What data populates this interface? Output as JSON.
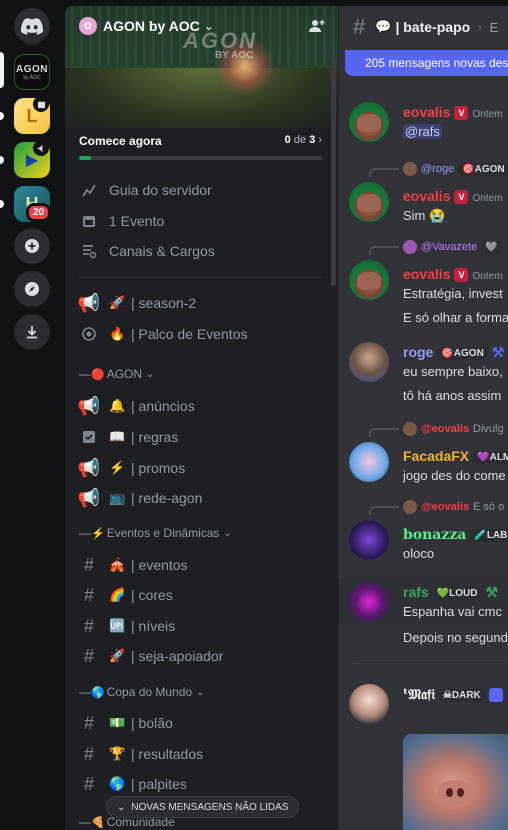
{
  "rail": {
    "servers": [
      {
        "name": "discord-home",
        "icon": "discord-logo-icon"
      },
      {
        "name": "AGON",
        "label": "AGON",
        "sublabel": "by AOC",
        "selected": true
      },
      {
        "name": "L-server",
        "label": "L"
      },
      {
        "name": "brazil-server",
        "label": "▶"
      },
      {
        "name": "H-server",
        "label": "H",
        "badge": "20"
      }
    ],
    "actions": [
      {
        "name": "add-server",
        "icon": "plus-icon"
      },
      {
        "name": "discover",
        "icon": "compass-icon"
      },
      {
        "name": "download",
        "icon": "download-icon"
      }
    ]
  },
  "sidebar": {
    "server_name": "AGON by AOC",
    "banner_logo": "AGON",
    "banner_logo_sub": "BY AOC",
    "start": {
      "label": "Comece agora",
      "done": "0",
      "of": "de",
      "total": "3",
      "progress": 0.05
    },
    "guide": [
      {
        "icon": "rocket-guide-icon",
        "label": "Guia do servidor"
      },
      {
        "icon": "calendar-icon",
        "label": "1 Evento"
      },
      {
        "icon": "channels-roles-icon",
        "label": "Canais & Cargos"
      }
    ],
    "top_channels": [
      {
        "type": "announcement",
        "emoji": "🚀",
        "label": "| season-2"
      },
      {
        "type": "stage",
        "emoji": "🔥",
        "label": "| Palco de Eventos"
      }
    ],
    "categories": [
      {
        "prefix": "—",
        "emoji": "🔴",
        "label": "AGON",
        "channels": [
          {
            "type": "announcement",
            "emoji": "🔔",
            "label": "| anúncios"
          },
          {
            "type": "rules",
            "emoji": "📖",
            "label": "| regras"
          },
          {
            "type": "announcement",
            "emoji": "⚡",
            "label": "| promos"
          },
          {
            "type": "announcement",
            "emoji": "📺",
            "label": "| rede-agon"
          }
        ]
      },
      {
        "prefix": "—",
        "emoji": "⚡",
        "label": "Eventos e Dinâmicas",
        "channels": [
          {
            "type": "text",
            "emoji": "🎪",
            "label": "| eventos"
          },
          {
            "type": "text",
            "emoji": "🌈",
            "label": "| cores"
          },
          {
            "type": "text",
            "emoji": "🆙",
            "label": "| níveis"
          },
          {
            "type": "text",
            "emoji": "🚀",
            "label": "| seja-apoiador"
          }
        ]
      },
      {
        "prefix": "—",
        "emoji": "🌎",
        "label": "Copa do Mundo",
        "channels": [
          {
            "type": "text",
            "emoji": "💵",
            "label": "| bolão"
          },
          {
            "type": "text",
            "emoji": "🏆",
            "label": "| resultados"
          },
          {
            "type": "text",
            "emoji": "🌎",
            "label": "| palpites"
          }
        ]
      },
      {
        "prefix": "—",
        "emoji": "🍕",
        "label": "Comunidade",
        "channels": []
      }
    ],
    "new_unread": "NOVAS MENSAGENS NÃO LIDAS"
  },
  "chat": {
    "channel_emoji": "💬",
    "channel_name": "| bate-papo",
    "topic": "E",
    "new_messages_bar": "205 mensagens novas desde",
    "messages": [
      {
        "author": "eovalis",
        "color": "#f23f43",
        "time": "Ontem",
        "text": "@rafs"
      },
      {
        "reply_to": "@roge",
        "reply_tag": "AGON",
        "author": "eovalis",
        "color": "#f23f43",
        "time": "Ontem",
        "text": "Sim 😭"
      },
      {
        "reply_to": "@Vavazete",
        "author": "eovalis",
        "color": "#f23f43",
        "time": "Ontem",
        "text": "Estratégia, invest",
        "text2": "E só olhar a forma"
      },
      {
        "author": "roge",
        "color": "#949cf7",
        "tag": "AGON",
        "text": "eu sempre baixo,",
        "text2": "tô há anos assim"
      },
      {
        "reply_to": "@eovalis",
        "reply_extra": "Divulg",
        "author": "FacadaFX",
        "color": "#f0b232",
        "tag": "ALM",
        "text": "jogo des do come"
      },
      {
        "reply_to": "@eovalis",
        "reply_extra": "E só o",
        "author": "bonazza",
        "color": "#57f287",
        "tag": "LAB",
        "text": "oloco"
      },
      {
        "author": "rafs",
        "color": "#3ba55c",
        "tag": "LOUD",
        "text": "Espanha vai cmc",
        "text2": "Depois no segundo"
      },
      {
        "author": "ᵗ𝔐𝔞𝔣𝔦",
        "color": "#ffffff",
        "tag": "DARK"
      }
    ]
  }
}
